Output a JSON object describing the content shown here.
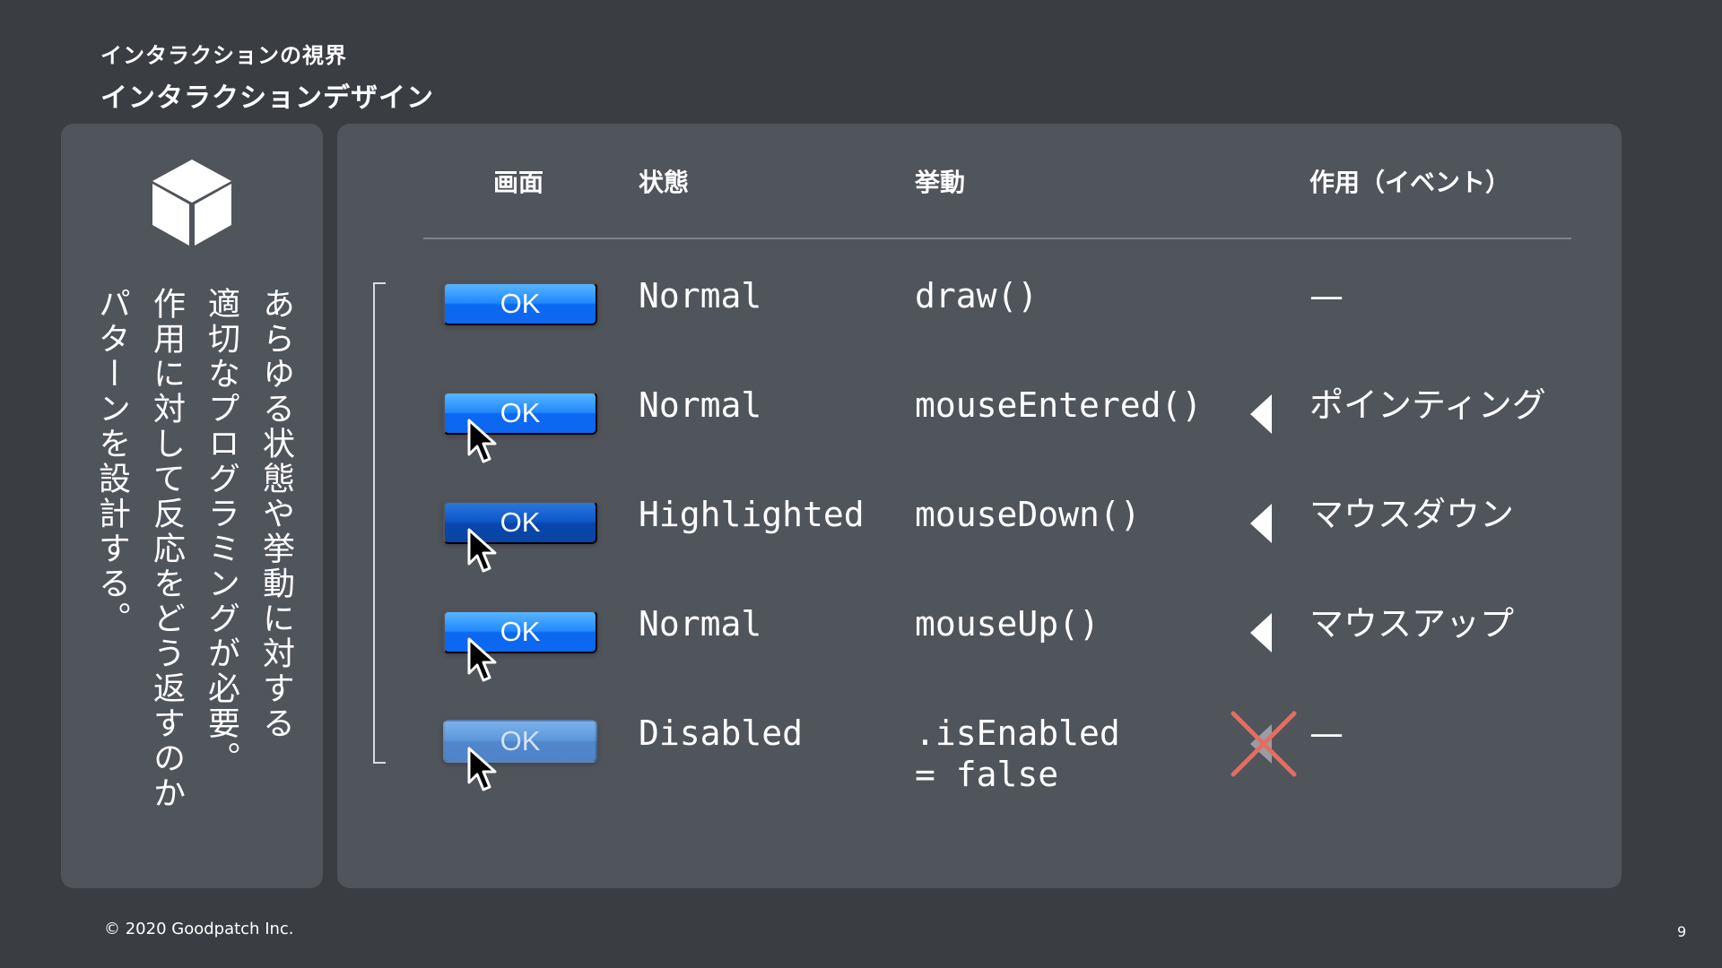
{
  "slide": {
    "eyebrow": "インタラクションの視界",
    "title": "インタラクションデザイン",
    "copyright": "© 2020 Goodpatch Inc.",
    "page_number": "9"
  },
  "left_panel": {
    "icon": "cube-icon",
    "lines": [
      "あらゆる状態や挙動に対する",
      "適切なプログラミングが必要。",
      "作用に対して反応をどう返すのか",
      "パターンを設計する。"
    ]
  },
  "table": {
    "headers": {
      "screen": "画面",
      "state": "状態",
      "behavior": "挙動",
      "event": "作用（イベント）"
    },
    "rows": [
      {
        "button_label": "OK",
        "button_style": "normal",
        "state": "Normal",
        "behavior": "draw()",
        "behavior_line2": "",
        "event": "—",
        "event_icon": "none",
        "has_pointer": false
      },
      {
        "button_label": "OK",
        "button_style": "normal",
        "state": "Normal",
        "behavior": "mouseEntered()",
        "behavior_line2": "",
        "event": "ポインティング",
        "event_icon": "left-triangle-icon",
        "has_pointer": true
      },
      {
        "button_label": "OK",
        "button_style": "highlighted",
        "state": "Highlighted",
        "behavior": "mouseDown()",
        "behavior_line2": "",
        "event": "マウスダウン",
        "event_icon": "left-triangle-icon",
        "has_pointer": true
      },
      {
        "button_label": "OK",
        "button_style": "normal",
        "state": "Normal",
        "behavior": "mouseUp()",
        "behavior_line2": "",
        "event": "マウスアップ",
        "event_icon": "left-triangle-icon",
        "has_pointer": true
      },
      {
        "button_label": "OK",
        "button_style": "disabled",
        "state": "Disabled",
        "behavior": ".isEnabled",
        "behavior_line2": "= false",
        "event": "—",
        "event_icon": "blocked-cross-icon",
        "has_pointer": true
      }
    ]
  },
  "colors": {
    "background": "#3a3d42",
    "card": "#50545b",
    "button_normal": "#1a7cf7",
    "button_highlighted": "#0d4fba",
    "button_disabled": "#5b93d8",
    "cross": "#e46d63",
    "text": "#ffffff"
  }
}
